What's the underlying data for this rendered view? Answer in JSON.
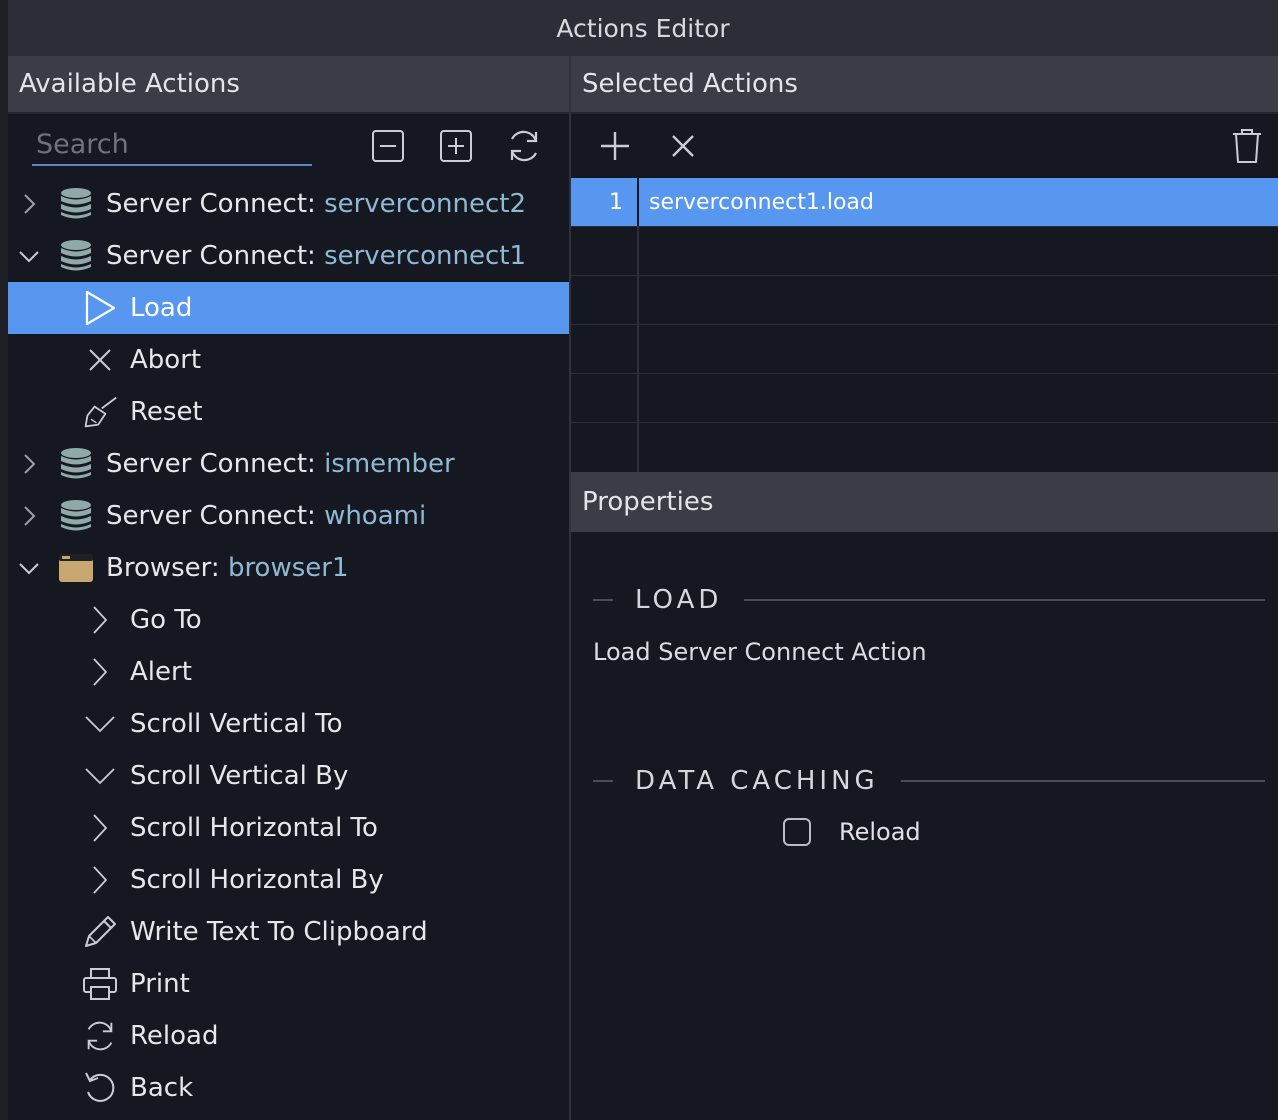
{
  "window": {
    "title": "Actions Editor"
  },
  "available": {
    "header": "Available Actions",
    "search_placeholder": "Search",
    "tree": [
      {
        "type": "group",
        "expanded": false,
        "prefix": "Server Connect: ",
        "name": "serverconnect2",
        "icon": "database-icon"
      },
      {
        "type": "group",
        "expanded": true,
        "prefix": "Server Connect: ",
        "name": "serverconnect1",
        "icon": "database-icon"
      },
      {
        "type": "child",
        "label": "Load",
        "icon": "play-icon",
        "selected": true
      },
      {
        "type": "child",
        "label": "Abort",
        "icon": "close-icon"
      },
      {
        "type": "child",
        "label": "Reset",
        "icon": "broom-icon"
      },
      {
        "type": "group",
        "expanded": false,
        "prefix": "Server Connect: ",
        "name": "ismember",
        "icon": "database-icon"
      },
      {
        "type": "group",
        "expanded": false,
        "prefix": "Server Connect: ",
        "name": "whoami",
        "icon": "database-icon"
      },
      {
        "type": "group",
        "expanded": true,
        "prefix": "Browser: ",
        "name": "browser1",
        "icon": "browser-window-icon"
      },
      {
        "type": "child",
        "label": "Go To",
        "icon": "chevron-right-icon"
      },
      {
        "type": "child",
        "label": "Alert",
        "icon": "chevron-right-icon"
      },
      {
        "type": "child",
        "label": "Scroll Vertical To",
        "icon": "chevron-down-icon"
      },
      {
        "type": "child",
        "label": "Scroll Vertical By",
        "icon": "chevron-down-icon"
      },
      {
        "type": "child",
        "label": "Scroll Horizontal To",
        "icon": "chevron-right-icon"
      },
      {
        "type": "child",
        "label": "Scroll Horizontal By",
        "icon": "chevron-right-icon"
      },
      {
        "type": "child",
        "label": "Write Text To Clipboard",
        "icon": "pencil-icon"
      },
      {
        "type": "child",
        "label": "Print",
        "icon": "printer-icon"
      },
      {
        "type": "child",
        "label": "Reload",
        "icon": "refresh-icon"
      },
      {
        "type": "child",
        "label": "Back",
        "icon": "undo-icon"
      }
    ]
  },
  "selected": {
    "header": "Selected Actions",
    "rows": [
      {
        "num": "1",
        "value": "serverconnect1.load",
        "selected": true
      },
      {
        "num": "",
        "value": ""
      },
      {
        "num": "",
        "value": ""
      },
      {
        "num": "",
        "value": ""
      },
      {
        "num": "",
        "value": ""
      },
      {
        "num": "",
        "value": ""
      }
    ]
  },
  "properties": {
    "header": "Properties",
    "section1_title": "LOAD",
    "section1_desc": "Load Server Connect Action",
    "section2_title": "DATA CACHING",
    "reload_label": "Reload",
    "reload_checked": false
  },
  "colors": {
    "accent": "#5797ef",
    "item_accent": "#8fb8d3",
    "database": "#8fa9a9",
    "browser_icon": "#c8a670"
  }
}
